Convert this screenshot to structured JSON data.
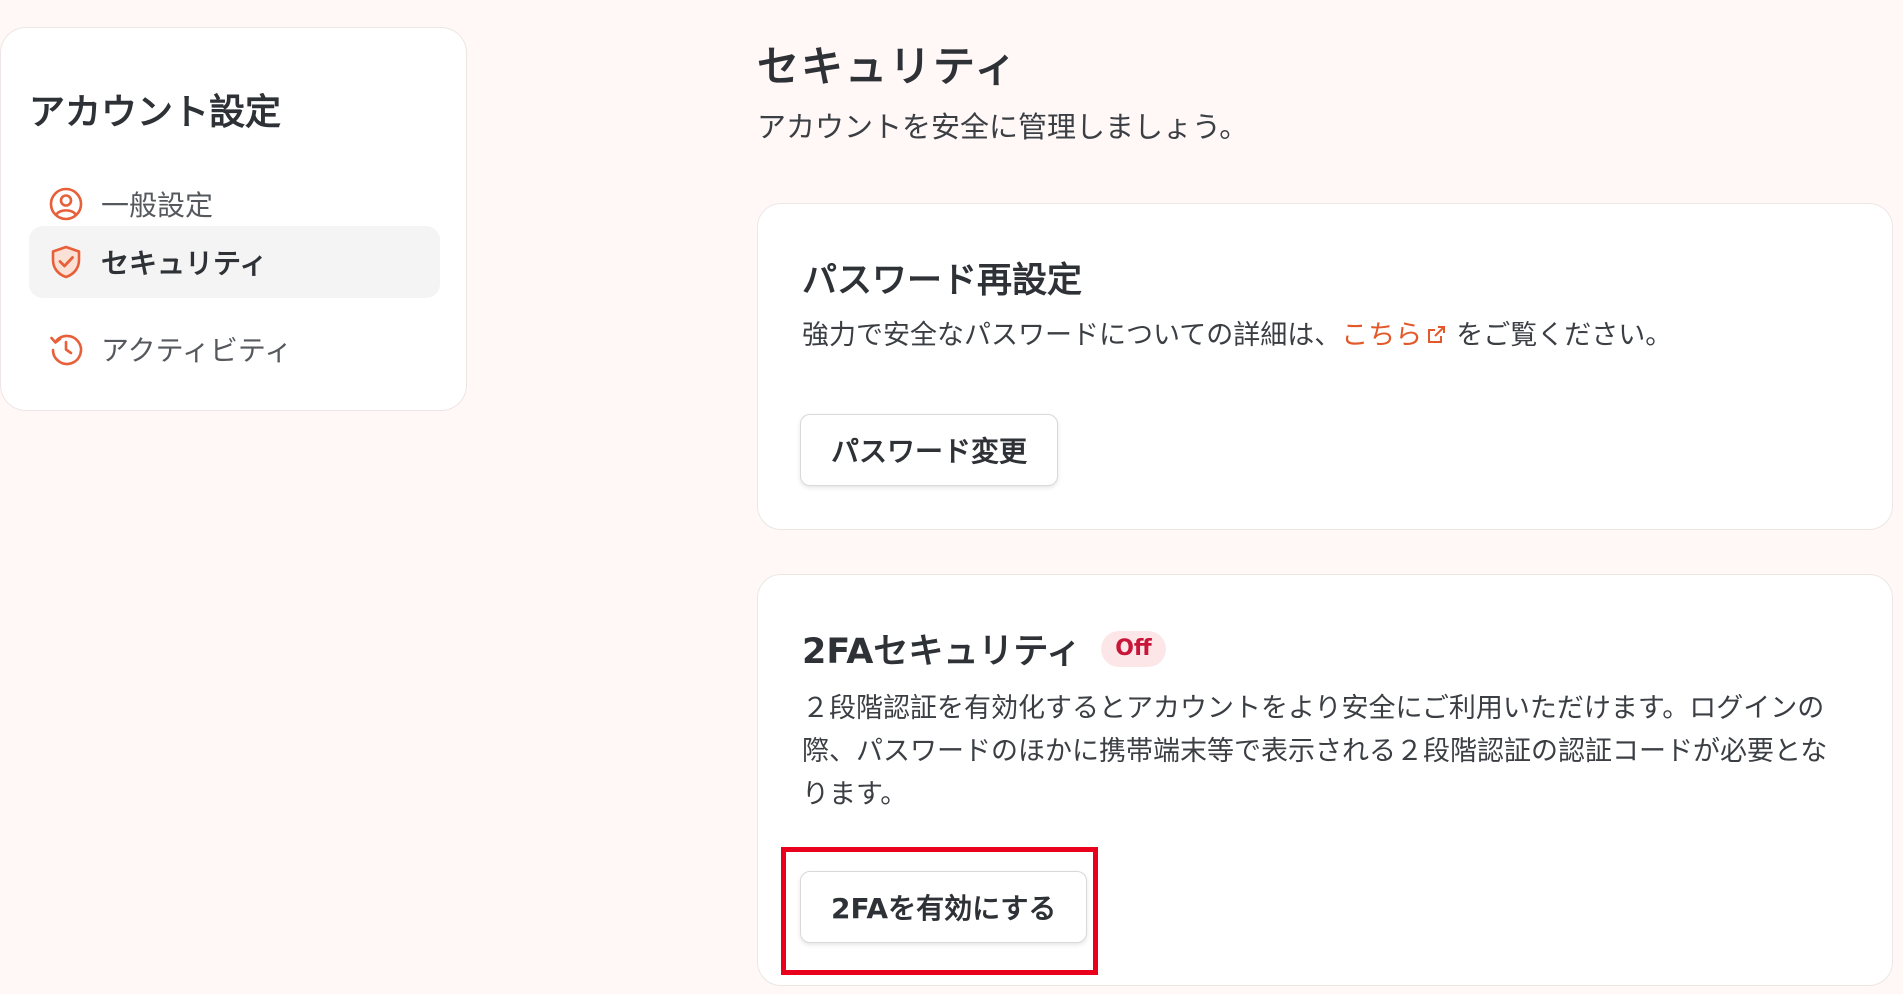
{
  "sidebar": {
    "title": "アカウント設定",
    "items": [
      {
        "label": "一般設定",
        "icon": "user-circle-icon"
      },
      {
        "label": "セキュリティ",
        "icon": "shield-check-icon",
        "active": true
      },
      {
        "label": "アクティビティ",
        "icon": "history-icon"
      }
    ]
  },
  "main": {
    "title": "セキュリティ",
    "subtitle": "アカウントを安全に管理しましょう。"
  },
  "password_card": {
    "title": "パスワード再設定",
    "text_before": "強力で安全なパスワードについての詳細は、",
    "link_text": "こちら",
    "link_icon": "external-link-icon",
    "text_after": "をご覧ください。",
    "button_label": "パスワード変更"
  },
  "twofa_card": {
    "title": "2FAセキュリティ",
    "badge": "Off",
    "description": "２段階認証を有効化するとアカウントをより安全にご利用いただけます。ログインの際、パスワードのほかに携帯端末等で表示される２段階認証の認証コードが必要となります。",
    "button_label": "2FAを有効にする"
  },
  "colors": {
    "accent": "#e25a2b",
    "badge_text": "#c8163a",
    "badge_bg": "#fde6e8",
    "highlight": "#e8001c",
    "background": "#fff8f7"
  }
}
